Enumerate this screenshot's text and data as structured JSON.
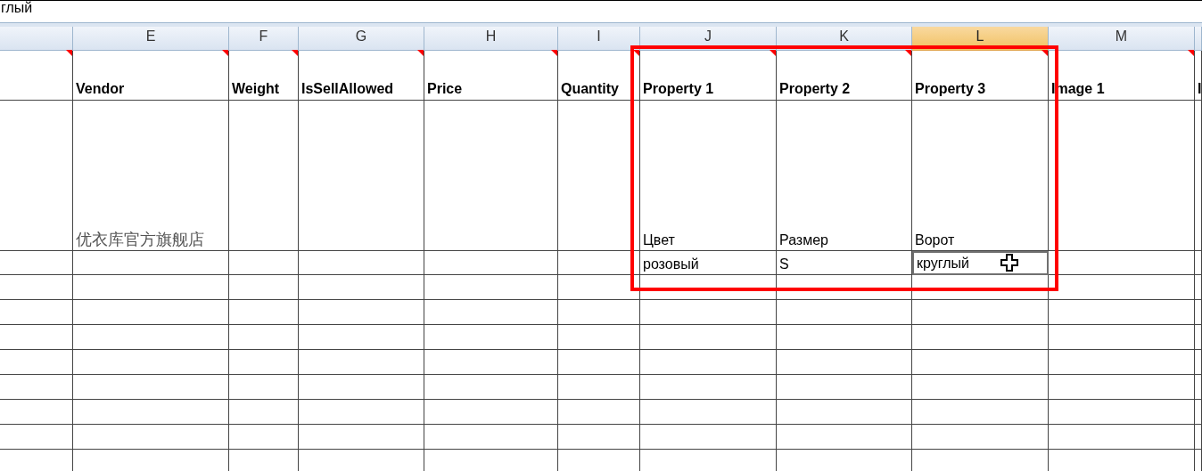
{
  "formula_bar": {
    "value": "глый"
  },
  "columns": [
    {
      "selected": false
    },
    {
      "letter": "E",
      "selected": false
    },
    {
      "letter": "F",
      "selected": false
    },
    {
      "letter": "G",
      "selected": false
    },
    {
      "letter": "H",
      "selected": false
    },
    {
      "letter": "I",
      "selected": false
    },
    {
      "letter": "J",
      "selected": false
    },
    {
      "letter": "K",
      "selected": false
    },
    {
      "letter": "L",
      "selected": true
    },
    {
      "letter": "M",
      "selected": false
    },
    {
      "selected": false
    }
  ],
  "header_row": [
    {
      "comment": true
    },
    {
      "text": "Vendor",
      "comment": true
    },
    {
      "text": "Weight",
      "comment": true
    },
    {
      "text": "IsSellAllowed",
      "comment": true
    },
    {
      "text": "Price",
      "comment": true
    },
    {
      "text": "Quantity",
      "comment": true
    },
    {
      "text": "Property 1",
      "comment": true
    },
    {
      "text": "Property 2",
      "comment": true
    },
    {
      "text": "Property 3",
      "comment": true
    },
    {
      "text": "Image 1",
      "comment": true
    },
    {
      "text": "I",
      "comment": false
    }
  ],
  "rows": [
    {
      "cells": [
        null,
        {
          "text": "优衣库官方旗舰店",
          "selected": false
        },
        null,
        null,
        null,
        null,
        {
          "text": "Цвет",
          "selected": false
        },
        {
          "text": "Размер",
          "selected": false
        },
        {
          "text": "Ворот",
          "selected": false
        },
        null,
        null
      ]
    },
    {
      "cells": [
        null,
        null,
        null,
        null,
        null,
        null,
        {
          "text": "розовый",
          "selected": false
        },
        {
          "text": "S",
          "selected": false
        },
        {
          "text": "круглый",
          "selected": true
        },
        null,
        null
      ]
    }
  ]
}
